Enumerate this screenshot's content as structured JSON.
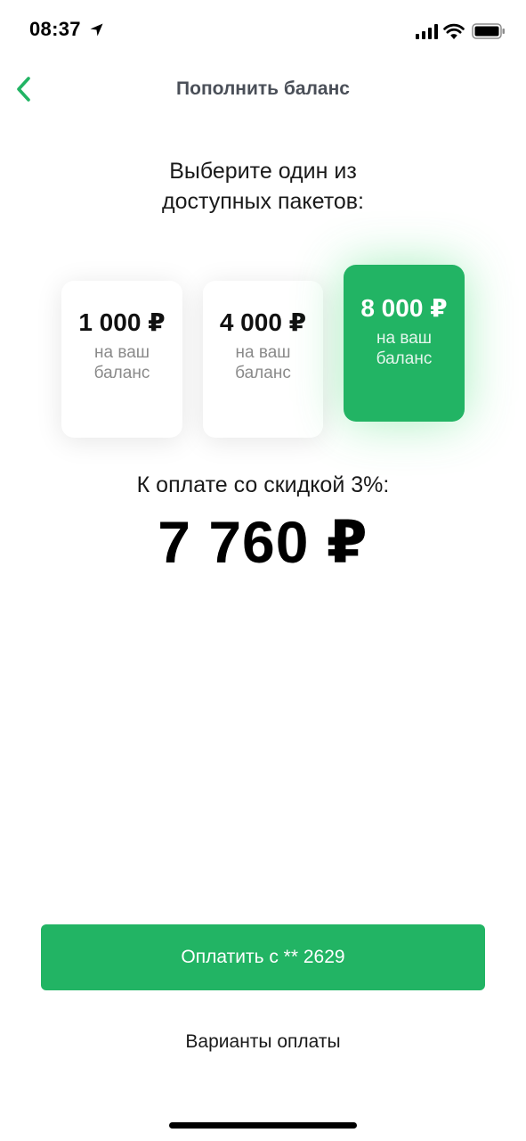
{
  "status_bar": {
    "time": "08:37"
  },
  "header": {
    "title": "Пополнить баланс",
    "back_icon": "chevron-left-icon"
  },
  "prompt": {
    "line1": "Выберите один из",
    "line2": "доступных пакетов:"
  },
  "packages": [
    {
      "amount": "1 000 ₽",
      "caption": "на ваш баланс",
      "selected": false
    },
    {
      "amount": "4 000 ₽",
      "caption": "на ваш баланс",
      "selected": false
    },
    {
      "amount": "8 000 ₽",
      "caption": "на ваш баланс",
      "selected": true
    }
  ],
  "payment": {
    "label": "К оплате со скидкой 3%:",
    "amount": "7 760 ₽"
  },
  "actions": {
    "pay_button": "Оплатить с ** 2629",
    "payment_options": "Варианты оплаты"
  },
  "colors": {
    "accent": "#22b464",
    "title_gray": "#4a4f58"
  }
}
